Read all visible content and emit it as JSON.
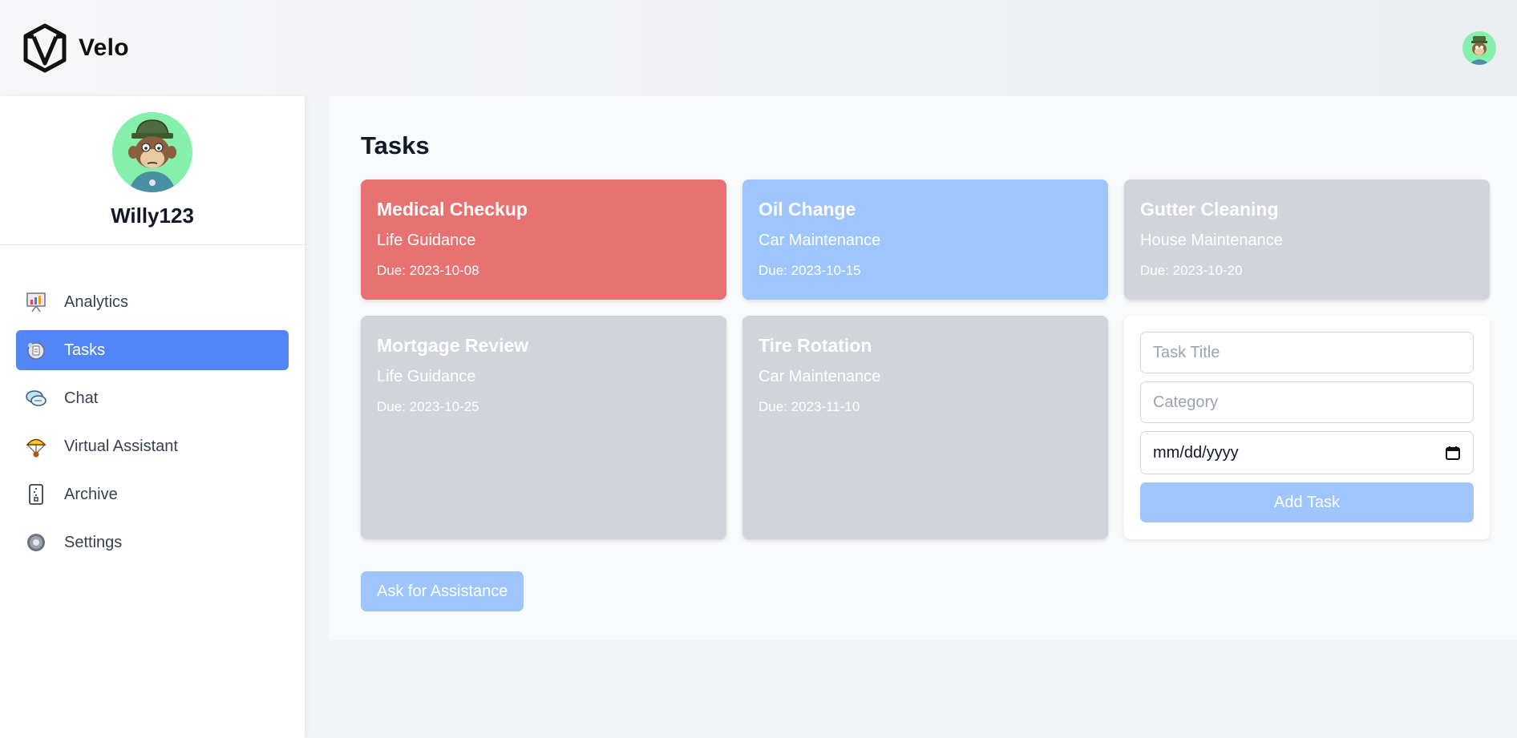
{
  "app": {
    "name": "Velo"
  },
  "user": {
    "username": "Willy123"
  },
  "nav": {
    "items": [
      {
        "label": "Analytics",
        "icon": "analytics-icon"
      },
      {
        "label": "Tasks",
        "icon": "tasks-icon",
        "active": true
      },
      {
        "label": "Chat",
        "icon": "chat-icon"
      },
      {
        "label": "Virtual Assistant",
        "icon": "parachute-icon"
      },
      {
        "label": "Archive",
        "icon": "archive-icon"
      },
      {
        "label": "Settings",
        "icon": "settings-icon"
      }
    ]
  },
  "main": {
    "title": "Tasks",
    "tasks": [
      {
        "title": "Medical Checkup",
        "category": "Life Guidance",
        "due": "Due: 2023-10-08",
        "color": "#e87272"
      },
      {
        "title": "Oil Change",
        "category": "Car Maintenance",
        "due": "Due: 2023-10-15",
        "color": "#9ec5fd"
      },
      {
        "title": "Gutter Cleaning",
        "category": "House Maintenance",
        "due": "Due: 2023-10-20",
        "color": "#d1d5db"
      },
      {
        "title": "Mortgage Review",
        "category": "Life Guidance",
        "due": "Due: 2023-10-25",
        "color": "#d1d5db"
      },
      {
        "title": "Tire Rotation",
        "category": "Car Maintenance",
        "due": "Due: 2023-11-10",
        "color": "#d1d5db"
      }
    ],
    "form": {
      "title_placeholder": "Task Title",
      "category_placeholder": "Category",
      "date_placeholder": "mm/dd/yyyy",
      "submit_label": "Add Task"
    },
    "assist_label": "Ask for Assistance"
  },
  "colors": {
    "accent": "#5285f5",
    "button": "#9ec5fd",
    "avatar_bg": "#86efac"
  }
}
